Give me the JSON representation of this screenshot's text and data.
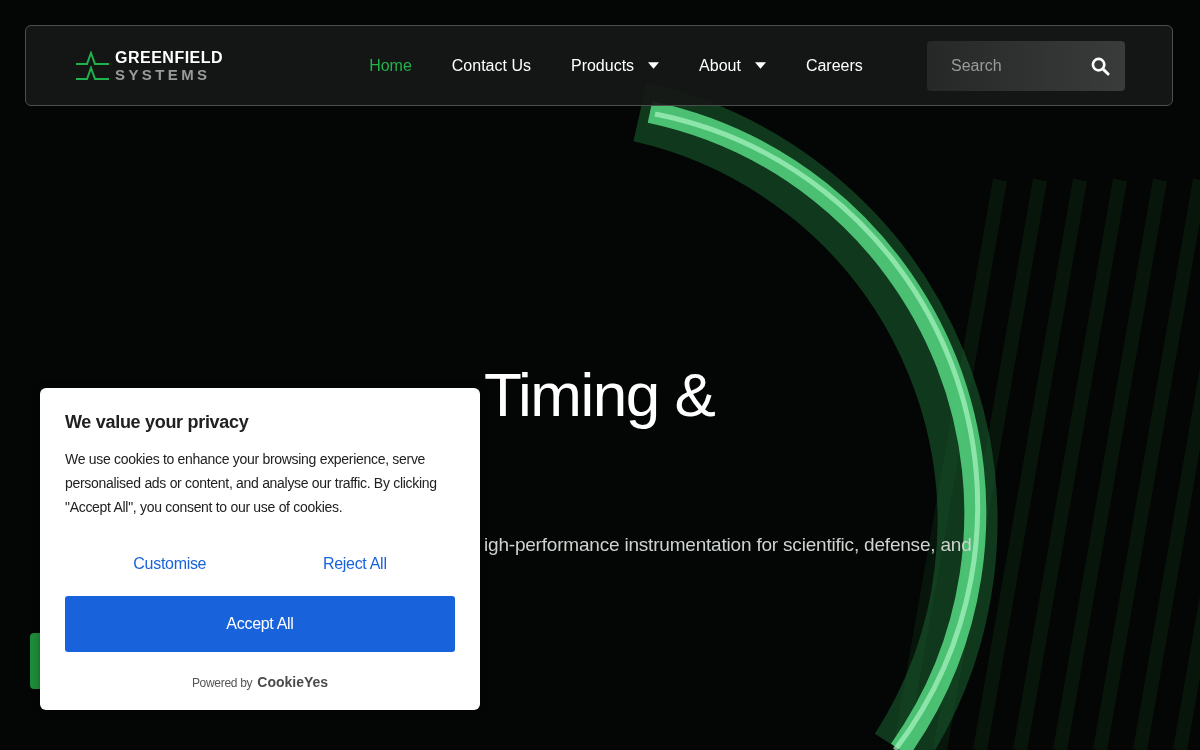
{
  "header": {
    "logo": {
      "line1": "GREENFIELD",
      "line2": "SYSTEMS"
    },
    "nav": [
      {
        "label": "Home",
        "selected": true,
        "dropdown": false
      },
      {
        "label": "Contact Us",
        "selected": false,
        "dropdown": false
      },
      {
        "label": "Products",
        "selected": false,
        "dropdown": true
      },
      {
        "label": "About",
        "selected": false,
        "dropdown": true
      },
      {
        "label": "Careers",
        "selected": false,
        "dropdown": false
      }
    ],
    "search": {
      "placeholder": "Search"
    }
  },
  "hero": {
    "title": "Timing &",
    "subtitle": "igh-performance instrumentation for scientific, defense, and"
  },
  "cookie_banner": {
    "title": "We value your privacy",
    "body": "We use cookies to enhance your browsing experience, serve personalised ads or content, and analyse our traffic. By clicking \"Accept All\", you consent to our use of cookies.",
    "links": [
      "Customise",
      "Reject All"
    ],
    "primary_button": "Accept All",
    "powered_by": "Powered by",
    "brand": "CookieYes"
  }
}
